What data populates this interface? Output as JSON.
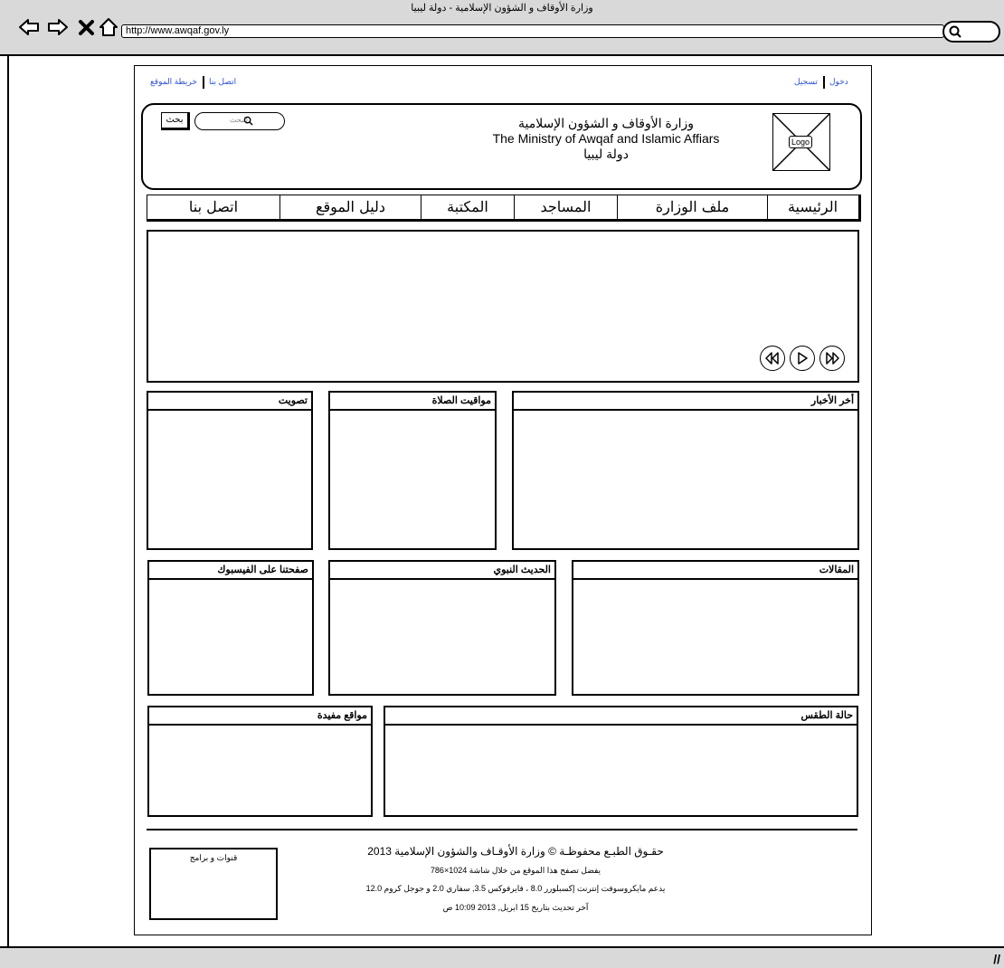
{
  "browser": {
    "window_title": "وزارة الأوقاف و الشؤون الإسلامية - دولة ليبيا",
    "url": "http://www.awqaf.gov.ly",
    "icons": [
      "back-arrow-icon",
      "forward-arrow-icon",
      "close-x-icon",
      "home-icon",
      "search-icon",
      "resize-grip-icon"
    ]
  },
  "top_links": {
    "left": [
      "اتصل بنا",
      "خريطة الموقع"
    ],
    "right": [
      "دخول",
      "تسجيل"
    ]
  },
  "header": {
    "title_ar": "وزارة الأوقاف و الشؤون الإسلامية",
    "title_en": "The Ministry of Awqaf and Islamic Affiars",
    "country": "دولة ليبيا",
    "logo_label": "Logo",
    "search_placeholder": "البحث",
    "search_button": "بحث"
  },
  "nav": [
    "الرئيسية",
    "ملف الوزارة",
    "المساجد",
    "المكتبة",
    "دليل الموقع",
    "اتصل بنا"
  ],
  "slider": {
    "controls": [
      "rewind-icon",
      "play-icon",
      "fast-forward-icon"
    ]
  },
  "panels": {
    "news": "أخر الأخبار",
    "prayer_times": "مواقيت الصلاة",
    "poll": "تصويت",
    "articles": "المقالات",
    "hadith": "الحديث النبوي",
    "facebook": "صفحتنا على الفيسبوك",
    "weather": "حالة الطقس",
    "useful_sites": "مواقع مفيدة"
  },
  "footer": {
    "channels": "قنوات و برامج",
    "copyright": "حقـوق الطبـع محفوظـة © وزارة الأوقـاف والشؤون الإسلامية 2013",
    "resolution": "يفضل تصفح هذا الموقع من خلال شاشة  1024×786",
    "browsers": "يدعم مايكروسوفت إنترنت إكسبلورر 8.0 ، فايرفوكس 3.5, سفاري 2.0 و جوجل كروم 12.0",
    "updated": "آخر تحديث بتاريخ 15 ابريل, 2013 10:09 ص"
  }
}
